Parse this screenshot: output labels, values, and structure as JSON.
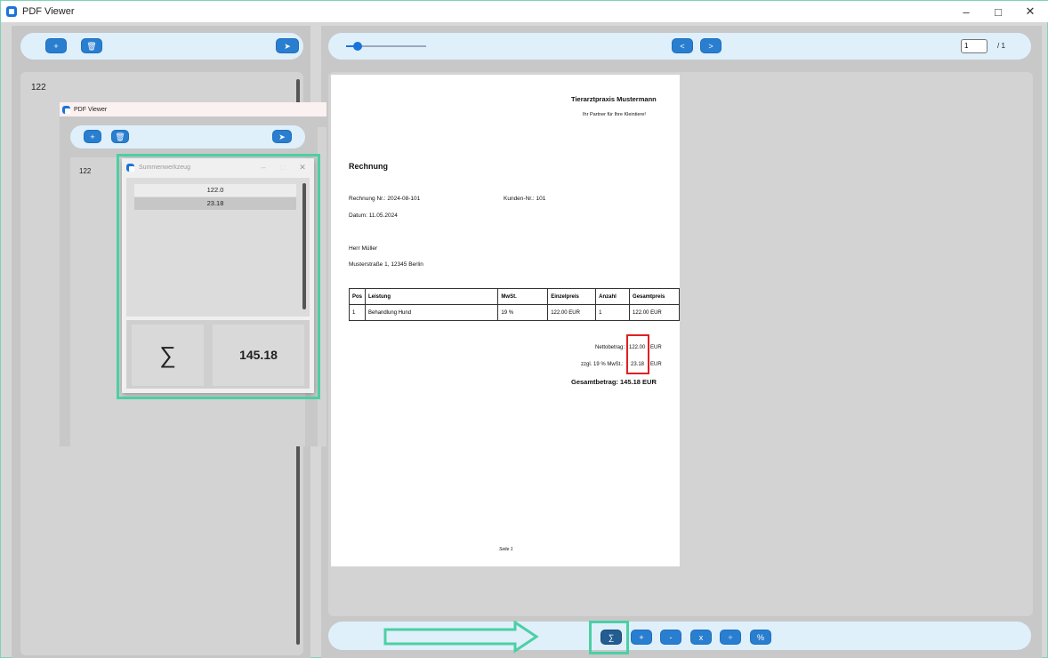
{
  "window": {
    "title": "PDF Viewer",
    "min": "–",
    "max": "□",
    "close": "✕"
  },
  "left_toolbar": {
    "add": "+",
    "delete": "🗑",
    "send": "➤"
  },
  "left_list": {
    "items": [
      "122"
    ]
  },
  "nested_window": {
    "title": "PDF Viewer",
    "add": "+",
    "delete": "🗑",
    "send": "➤",
    "list_items": [
      "122"
    ]
  },
  "sum_tool": {
    "title": "Summenwerkzeug",
    "min": "–",
    "max": "□",
    "close": "✕",
    "values": [
      "122.0",
      "23.18"
    ],
    "sum_symbol": "∑",
    "total": "145.18"
  },
  "viewer_toolbar": {
    "zoom_level": 0.14,
    "prev": "<",
    "next": ">",
    "page_input": "1",
    "page_total": "/ 1"
  },
  "document": {
    "company": "Tierarztpraxis Mustermann",
    "tagline": "Ihr Partner für Ihre Kleintiere!",
    "heading": "Rechnung",
    "invoice_no": "Rechnung Nr.: 2024-08-101",
    "customer_no": "Kunden-Nr.: 101",
    "date": "Datum: 11.05.2024",
    "recipient_name": "Herr Müller",
    "recipient_address": "Musterstraße 1, 12345 Berlin",
    "table_headers": [
      "Pos",
      "Leistung",
      "MwSt.",
      "Einzelpreis",
      "Anzahl",
      "Gesamtpreis"
    ],
    "table_row": [
      "1",
      "Behandlung Hund",
      "19 %",
      "122.00 EUR",
      "1",
      "122.00 EUR"
    ],
    "net_label": "Nettobetrag:",
    "net_value": "122.00",
    "net_unit": "EUR",
    "tax_label": "zzgl. 19 % MwSt.:",
    "tax_value": "23.18",
    "tax_unit": "EUR",
    "total": "Gesamtbetrag: 145.18 EUR",
    "footer": "Seite 1"
  },
  "bottom_toolbar": {
    "sum": "∑",
    "add": "+",
    "sub": "-",
    "mul": "x",
    "div": "÷",
    "pct": "%"
  },
  "colors": {
    "accent": "#2a7ed0",
    "highlight": "#4ccfa4",
    "marker": "#e02020"
  }
}
